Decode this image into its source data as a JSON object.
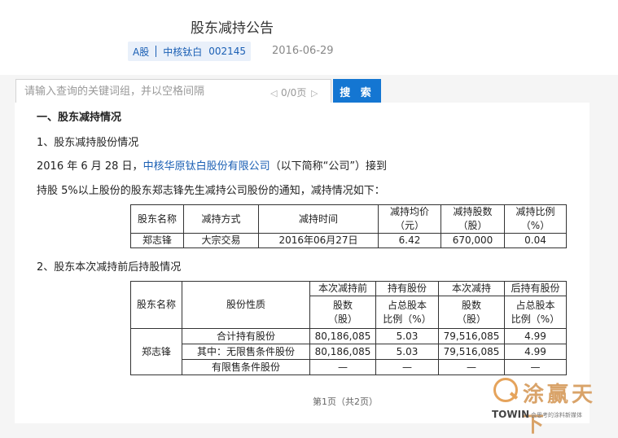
{
  "header": {
    "title": "股东减持公告",
    "tag_market": "A股",
    "tag_company": "中核钛白",
    "tag_code": "002145",
    "date": "2016-06-29"
  },
  "search": {
    "placeholder": "请输入查询的关键词组，并以空格间隔",
    "page_count": "0/0页",
    "button_label": "搜 索"
  },
  "document": {
    "section_heading": "一、股东减持情况",
    "sub_heading_1": "1、股东减持股份情况",
    "para1_before": "2016 年 6 月 28 日，",
    "para1_link": "中核华原钛白股份有限公司",
    "para1_after": "（以下简称“公司”）接到",
    "para2": "持股 5%以上股份的股东郑志锋先生减持公司股份的通知，减持情况如下：",
    "sub_heading_2": "2、股东本次减持前后持股情况"
  },
  "table1": {
    "headers": [
      "股东名称",
      "减持方式",
      "减持时间",
      "减持均价",
      "（元）",
      "减持股数",
      "（股）",
      "减持比例",
      "（%）"
    ],
    "row": [
      "郑志锋",
      "大宗交易",
      "2016年06月27日",
      "6.42",
      "670,000",
      "0.04"
    ]
  },
  "table2": {
    "group_before": "本次减持前",
    "group_before_2": "持有股份",
    "group_after": "本次减持",
    "group_after_2": "后持有股份",
    "col_holder": "股东名称",
    "col_nature": "股份性质",
    "col_shares_1": "股数",
    "col_shares_2": "（股）",
    "col_ratio_1": "占总股本",
    "col_ratio_2": "比例（%）",
    "holder": "郑志锋",
    "rows": [
      [
        "合计持有股份",
        "80,186,085",
        "5.03",
        "79,516,085",
        "4.99"
      ],
      [
        "其中：无限售条件股份",
        "80,186,085",
        "5.03",
        "79,516,085",
        "4.99"
      ],
      [
        "有限售条件股份",
        "—",
        "—",
        "—",
        "—"
      ]
    ]
  },
  "pagination": "第1页（共2页）",
  "watermark": {
    "cn": "涂赢天下",
    "en": "TOWIN",
    "slogan": "会思考的涂料新媒体"
  }
}
